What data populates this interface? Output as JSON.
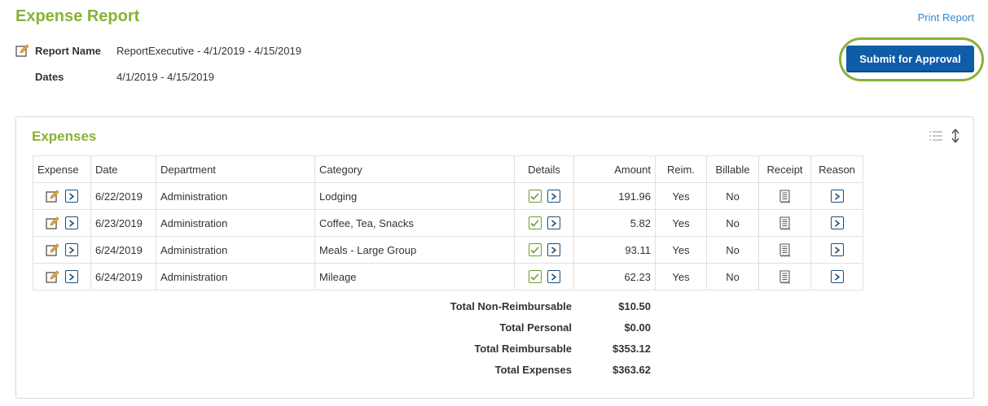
{
  "header": {
    "title": "Expense Report",
    "print_label": "Print Report",
    "submit_label": "Submit for Approval"
  },
  "report": {
    "name_label": "Report Name",
    "name_value": "ReportExecutive - 4/1/2019 - 4/15/2019",
    "dates_label": "Dates",
    "dates_value": "4/1/2019 - 4/15/2019"
  },
  "expenses": {
    "title": "Expenses",
    "columns": {
      "expense": "Expense",
      "date": "Date",
      "department": "Department",
      "category": "Category",
      "details": "Details",
      "amount": "Amount",
      "reim": "Reim.",
      "billable": "Billable",
      "receipt": "Receipt",
      "reason": "Reason"
    },
    "rows": [
      {
        "date": "6/22/2019",
        "department": "Administration",
        "category": "Lodging",
        "amount": "191.96",
        "reim": "Yes",
        "billable": "No"
      },
      {
        "date": "6/23/2019",
        "department": "Administration",
        "category": "Coffee, Tea, Snacks",
        "amount": "5.82",
        "reim": "Yes",
        "billable": "No"
      },
      {
        "date": "6/24/2019",
        "department": "Administration",
        "category": "Meals - Large Group",
        "amount": "93.11",
        "reim": "Yes",
        "billable": "No"
      },
      {
        "date": "6/24/2019",
        "department": "Administration",
        "category": "Mileage",
        "amount": "62.23",
        "reim": "Yes",
        "billable": "No"
      }
    ],
    "totals": [
      {
        "label": "Total Non-Reimbursable",
        "value": "$10.50"
      },
      {
        "label": "Total Personal",
        "value": "$0.00"
      },
      {
        "label": "Total Reimbursable",
        "value": "$353.12"
      },
      {
        "label": "Total Expenses",
        "value": "$363.62"
      }
    ]
  },
  "colors": {
    "accent_green": "#8ab135",
    "primary_blue": "#0f5ca8",
    "link_blue": "#3a86c8",
    "icon_navy": "#1e4e7a"
  },
  "icons": {
    "edit": "edit-icon",
    "chevron": "chevron-right-icon",
    "check": "checkbox-checked-icon",
    "receipt": "receipt-icon",
    "list": "list-view-icon",
    "sort": "sort-icon"
  }
}
